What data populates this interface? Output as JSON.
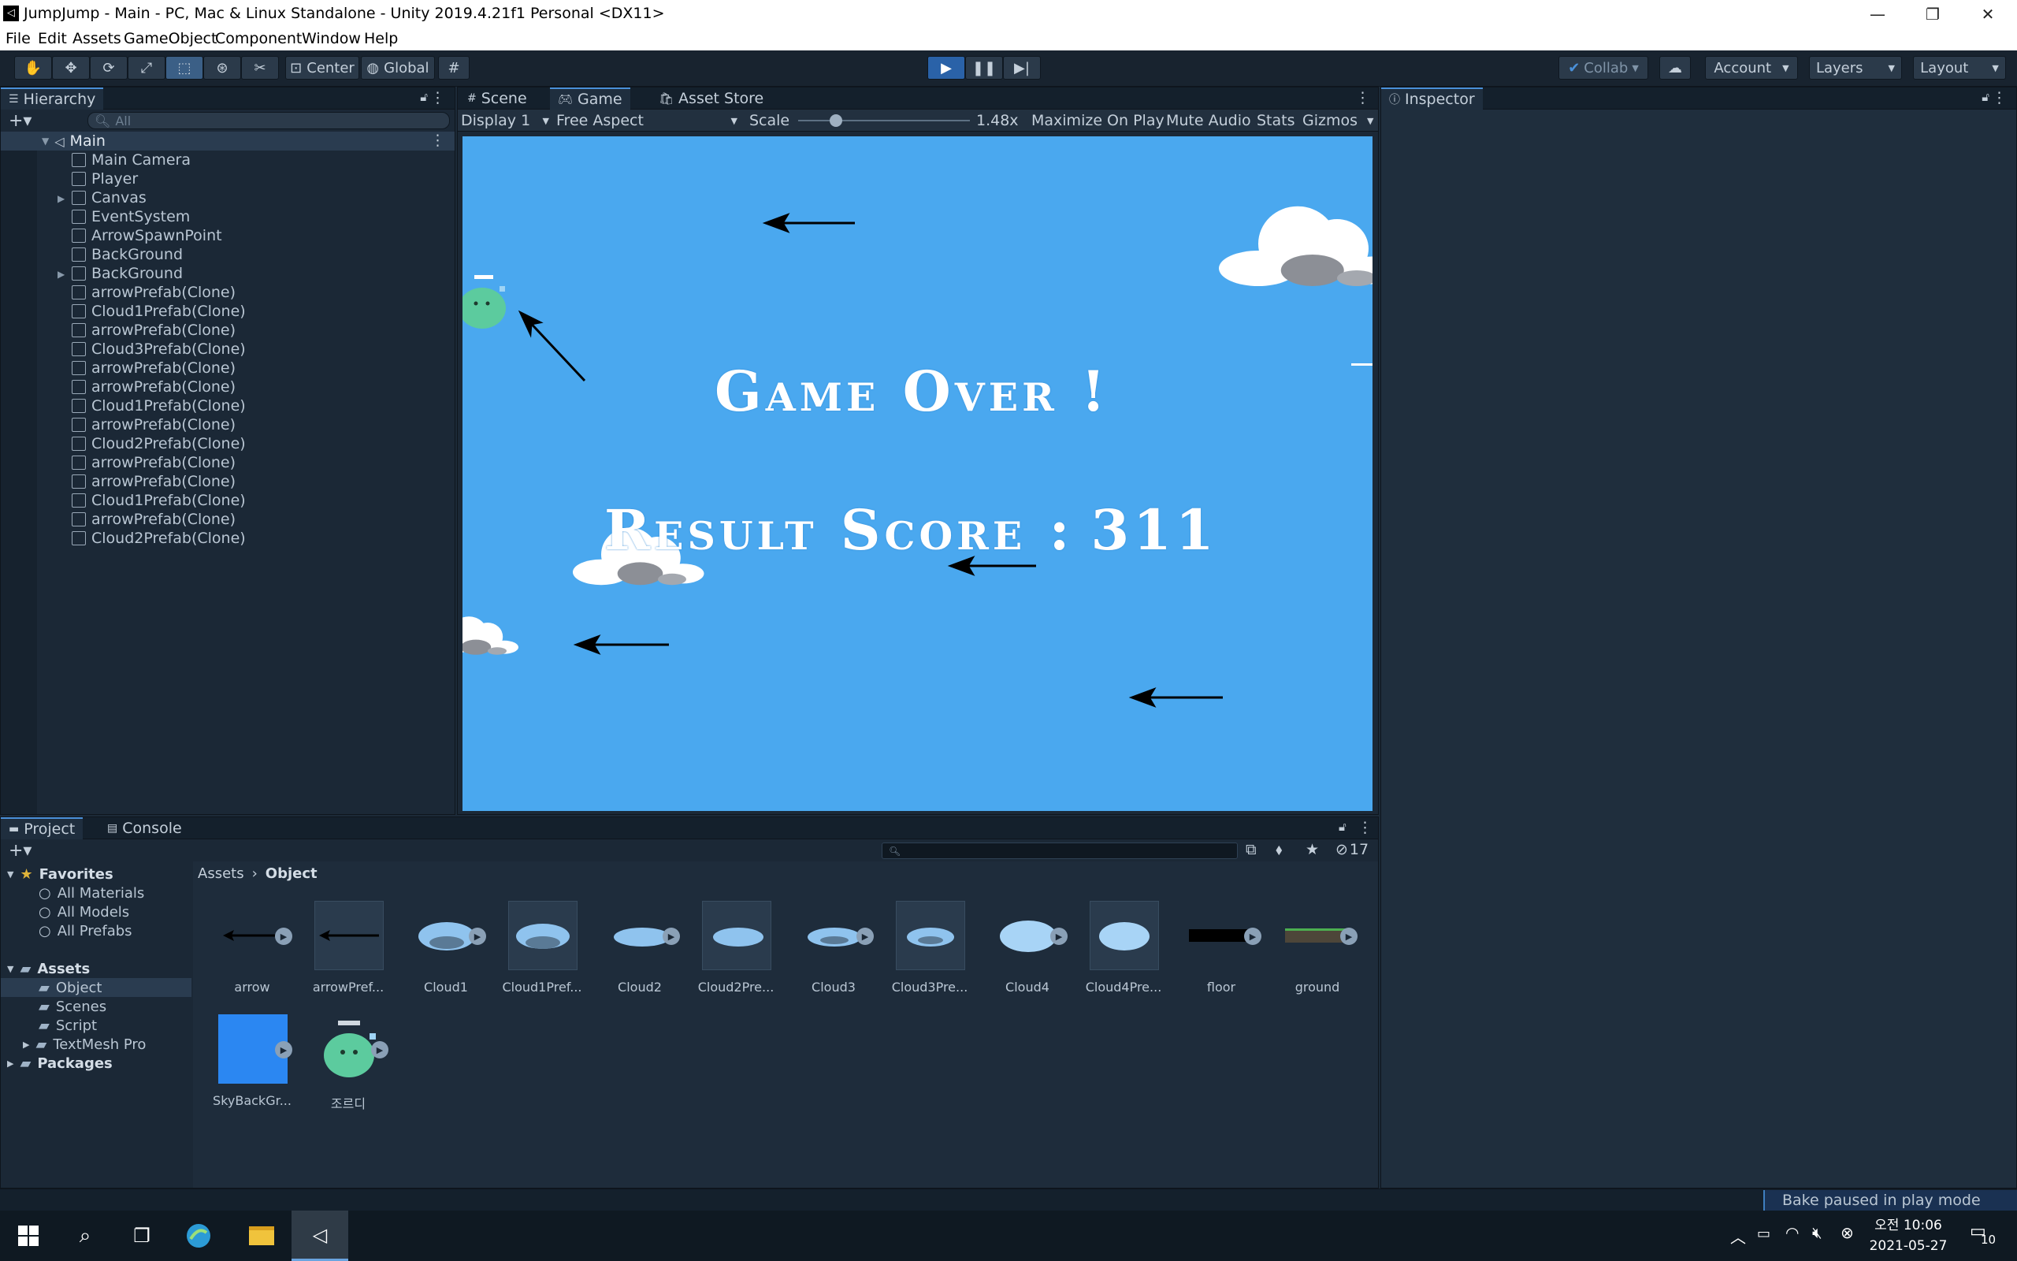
{
  "window": {
    "title": "JumpJump - Main - PC, Mac & Linux Standalone - Unity 2019.4.21f1 Personal <DX11>"
  },
  "menu": [
    "File",
    "Edit",
    "Assets",
    "GameObject",
    "Component",
    "Window",
    "Help"
  ],
  "toolbar": {
    "center_label": "Center",
    "global_label": "Global",
    "collab_label": "Collab",
    "account_label": "Account",
    "layers_label": "Layers",
    "layout_label": "Layout"
  },
  "hierarchy": {
    "tab": "Hierarchy",
    "search_placeholder": "All",
    "scene": "Main",
    "items": [
      "Main Camera",
      "Player",
      "Canvas",
      "EventSystem",
      "ArrowSpawnPoint",
      "BackGround",
      "BackGround",
      "arrowPrefab(Clone)",
      "Cloud1Prefab(Clone)",
      "arrowPrefab(Clone)",
      "Cloud3Prefab(Clone)",
      "arrowPrefab(Clone)",
      "arrowPrefab(Clone)",
      "Cloud1Prefab(Clone)",
      "arrowPrefab(Clone)",
      "Cloud2Prefab(Clone)",
      "arrowPrefab(Clone)",
      "arrowPrefab(Clone)",
      "Cloud1Prefab(Clone)",
      "arrowPrefab(Clone)",
      "Cloud2Prefab(Clone)"
    ]
  },
  "center_tabs": {
    "scene": "Scene",
    "game": "Game",
    "asset_store": "Asset Store"
  },
  "game_toolbar": {
    "display": "Display 1",
    "aspect": "Free Aspect",
    "scale_label": "Scale",
    "scale_value": "1.48x",
    "maximize": "Maximize On Play",
    "mute": "Mute Audio",
    "stats": "Stats",
    "gizmos": "Gizmos"
  },
  "game": {
    "title": "Game Over !",
    "score_label": "Result Score :",
    "score_value": "311"
  },
  "inspector": {
    "tab": "Inspector"
  },
  "project": {
    "tab_project": "Project",
    "tab_console": "Console",
    "hidden_count": "17",
    "breadcrumb": [
      "Assets",
      "Object"
    ],
    "favorites": {
      "title": "Favorites",
      "items": [
        "All Materials",
        "All Models",
        "All Prefabs"
      ]
    },
    "assets": {
      "title": "Assets",
      "items": [
        "Object",
        "Scenes",
        "Script",
        "TextMesh Pro"
      ]
    },
    "packages": "Packages",
    "grid": [
      "arrow",
      "arrowPref...",
      "Cloud1",
      "Cloud1Pref...",
      "Cloud2",
      "Cloud2Pre...",
      "Cloud3",
      "Cloud3Pre...",
      "Cloud4",
      "Cloud4Pre...",
      "floor",
      "ground",
      "SkyBackGr...",
      "조르디"
    ]
  },
  "status": {
    "message": "Bake paused in play mode"
  },
  "taskbar": {
    "time": "오전 10:06",
    "date": "2021-05-27",
    "notifications": "10"
  }
}
